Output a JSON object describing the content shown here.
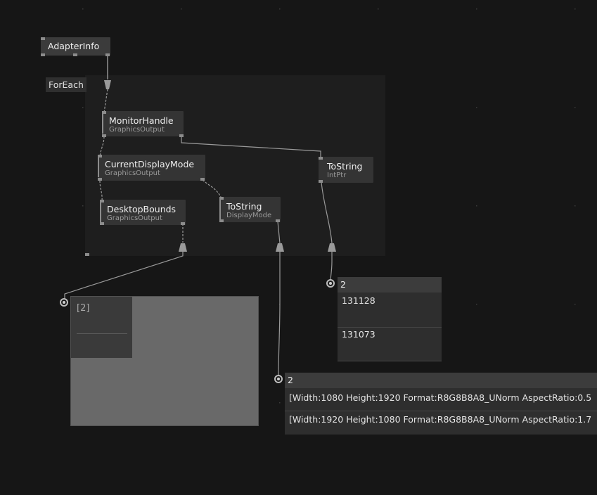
{
  "colors": {
    "background": "#161616",
    "region": "#1e1e1e",
    "node": "#343434",
    "link": "#9a9a9a"
  },
  "region": {
    "label": "ForEach"
  },
  "nodes": {
    "adapter_info": {
      "title": "AdapterInfo"
    },
    "monitor_handle": {
      "title": "MonitorHandle",
      "subtitle": "GraphicsOutput"
    },
    "current_display_mode": {
      "title": "CurrentDisplayMode",
      "subtitle": "GraphicsOutput"
    },
    "desktop_bounds": {
      "title": "DesktopBounds",
      "subtitle": "GraphicsOutput"
    },
    "to_string_display": {
      "title": "ToString",
      "subtitle": "DisplayMode"
    },
    "to_string_intptr": {
      "title": "ToString",
      "subtitle": "IntPtr"
    }
  },
  "viewers": {
    "bounds_preview": {
      "label": "[2]"
    },
    "handles": {
      "count": "2",
      "rows": [
        "131128",
        "131073"
      ]
    },
    "modes": {
      "count": "2",
      "rows": [
        "[Width:1080 Height:1920 Format:R8G8B8A8_UNorm AspectRatio:0.5",
        "[Width:1920 Height:1080 Format:R8G8B8A8_UNorm AspectRatio:1.7"
      ]
    }
  }
}
